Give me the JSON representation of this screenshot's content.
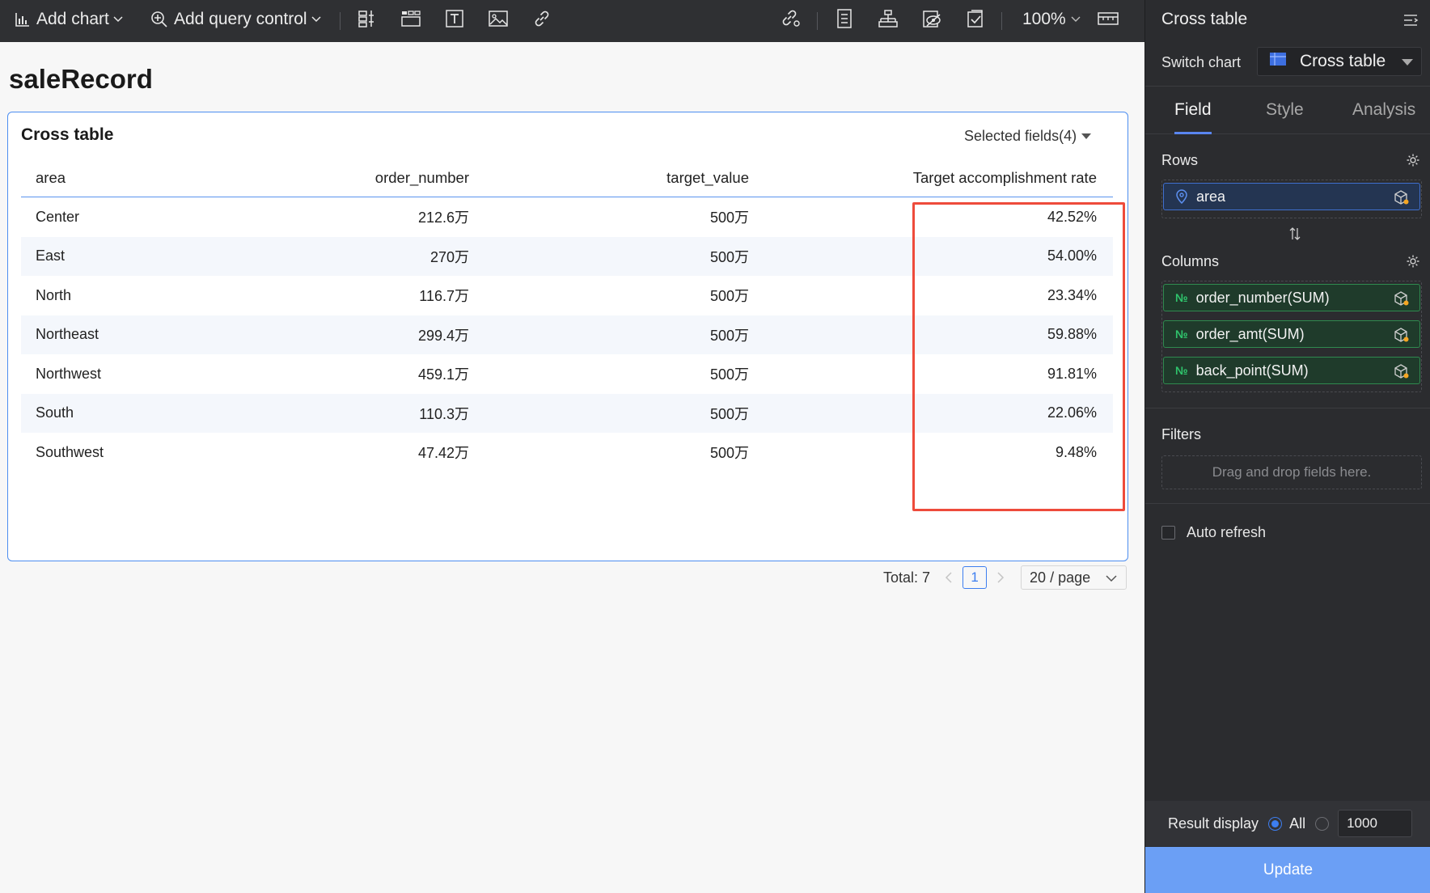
{
  "toolbar": {
    "add_chart": "Add chart",
    "add_query_control": "Add query control",
    "zoom": "100%"
  },
  "canvas": {
    "page_title": "saleRecord",
    "card": {
      "title": "Cross table",
      "selected_fields": "Selected fields(4)",
      "columns": [
        "area",
        "order_number",
        "target_value",
        "Target accomplishment rate"
      ],
      "rows": [
        [
          "Center",
          "212.6万",
          "500万",
          "42.52%"
        ],
        [
          "East",
          "270万",
          "500万",
          "54.00%"
        ],
        [
          "North",
          "116.7万",
          "500万",
          "23.34%"
        ],
        [
          "Northeast",
          "299.4万",
          "500万",
          "59.88%"
        ],
        [
          "Northwest",
          "459.1万",
          "500万",
          "91.81%"
        ],
        [
          "South",
          "110.3万",
          "500万",
          "22.06%"
        ],
        [
          "Southwest",
          "47.42万",
          "500万",
          "9.48%"
        ]
      ],
      "pagination": {
        "total": "Total: 7",
        "current_page": "1",
        "page_size": "20 / page"
      }
    }
  },
  "panel": {
    "title": "Cross table",
    "switch_chart_label": "Switch chart",
    "switch_chart_value": "Cross table",
    "tabs": [
      "Field",
      "Style",
      "Analysis"
    ],
    "rows_label": "Rows",
    "rows_fields": [
      "area"
    ],
    "columns_label": "Columns",
    "columns_fields": [
      "order_number(SUM)",
      "order_amt(SUM)",
      "back_point(SUM)"
    ],
    "measure_prefix": "№",
    "filters_label": "Filters",
    "filters_hint": "Drag and drop fields here.",
    "auto_refresh": "Auto refresh",
    "result_display_label": "Result display",
    "result_all": "All",
    "result_limit": "1000",
    "update_button": "Update"
  },
  "colors": {
    "accent": "#3d7ef0",
    "highlight": "#ee4b3b",
    "panel_bg": "#2b2c2f",
    "toolbar_bg": "#2f3033",
    "measure_green": "#2fc46c"
  }
}
